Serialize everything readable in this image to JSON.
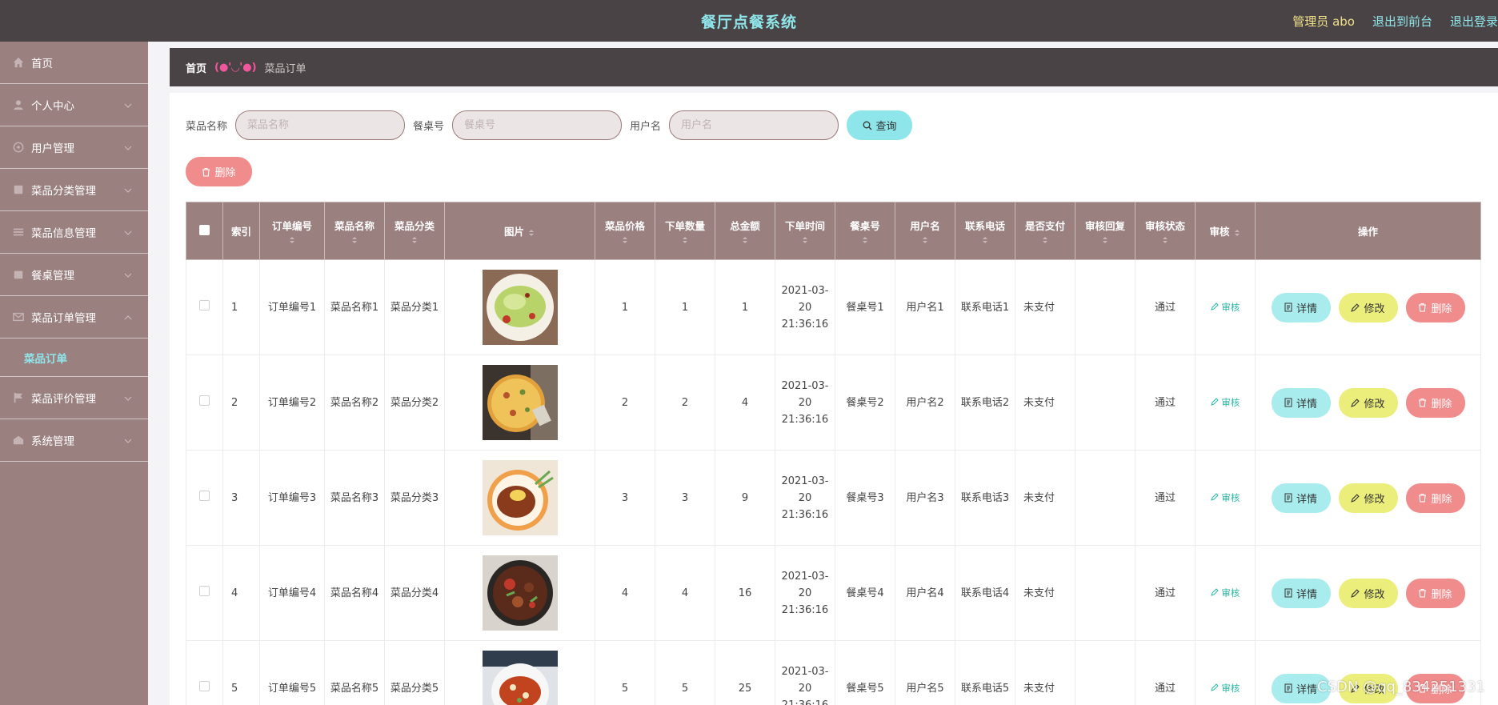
{
  "header": {
    "title": "餐厅点餐系统",
    "admin": "管理员 abo",
    "to_front": "退出到前台",
    "logout": "退出登录"
  },
  "sidebar": {
    "items": [
      {
        "label": "首页",
        "icon": "home-icon"
      },
      {
        "label": "个人中心",
        "icon": "user-icon"
      },
      {
        "label": "用户管理",
        "icon": "users-icon"
      },
      {
        "label": "菜品分类管理",
        "icon": "category-icon"
      },
      {
        "label": "菜品信息管理",
        "icon": "list-icon"
      },
      {
        "label": "餐桌管理",
        "icon": "table-icon"
      },
      {
        "label": "菜品订单管理",
        "icon": "order-icon"
      },
      {
        "label": "菜品评价管理",
        "icon": "flag-icon"
      },
      {
        "label": "系统管理",
        "icon": "system-icon"
      }
    ],
    "active_sub": "菜品订单"
  },
  "breadcrumb": {
    "home": "首页",
    "sep": "(●'◡'●)",
    "current": "菜品订单"
  },
  "search": {
    "dish_label": "菜品名称",
    "dish_placeholder": "菜品名称",
    "table_label": "餐桌号",
    "table_placeholder": "餐桌号",
    "user_label": "用户名",
    "user_placeholder": "用户名",
    "query_label": "查询"
  },
  "toolbar": {
    "delete_label": "删除"
  },
  "table": {
    "headers": [
      "索引",
      "订单编号",
      "菜品名称",
      "菜品分类",
      "图片",
      "菜品价格",
      "下单数量",
      "总金额",
      "下单时间",
      "餐桌号",
      "用户名",
      "联系电话",
      "是否支付",
      "审核回复",
      "审核状态",
      "审核",
      "操作"
    ],
    "review_link": "审核",
    "op_detail": "详情",
    "op_edit": "修改",
    "op_delete": "删除",
    "rows": [
      {
        "idx": "1",
        "order": "订单编号1",
        "dish": "菜品名称1",
        "cat": "菜品分类1",
        "price": "1",
        "qty": "1",
        "total": "1",
        "time": "2021-03-20 21:36:16",
        "table": "餐桌号1",
        "user": "用户名1",
        "phone": "联系电话1",
        "paid": "未支付",
        "reply": "",
        "status": "通过"
      },
      {
        "idx": "2",
        "order": "订单编号2",
        "dish": "菜品名称2",
        "cat": "菜品分类2",
        "price": "2",
        "qty": "2",
        "total": "4",
        "time": "2021-03-20 21:36:16",
        "table": "餐桌号2",
        "user": "用户名2",
        "phone": "联系电话2",
        "paid": "未支付",
        "reply": "",
        "status": "通过"
      },
      {
        "idx": "3",
        "order": "订单编号3",
        "dish": "菜品名称3",
        "cat": "菜品分类3",
        "price": "3",
        "qty": "3",
        "total": "9",
        "time": "2021-03-20 21:36:16",
        "table": "餐桌号3",
        "user": "用户名3",
        "phone": "联系电话3",
        "paid": "未支付",
        "reply": "",
        "status": "通过"
      },
      {
        "idx": "4",
        "order": "订单编号4",
        "dish": "菜品名称4",
        "cat": "菜品分类4",
        "price": "4",
        "qty": "4",
        "total": "16",
        "time": "2021-03-20 21:36:16",
        "table": "餐桌号4",
        "user": "用户名4",
        "phone": "联系电话4",
        "paid": "未支付",
        "reply": "",
        "status": "通过"
      },
      {
        "idx": "5",
        "order": "订单编号5",
        "dish": "菜品名称5",
        "cat": "菜品分类5",
        "price": "5",
        "qty": "5",
        "total": "25",
        "time": "2021-03-20 21:36:16",
        "table": "餐桌号5",
        "user": "用户名5",
        "phone": "联系电话5",
        "paid": "未支付",
        "reply": "",
        "status": "通过"
      }
    ]
  },
  "watermark": "CSDN @qq_834251331",
  "colors": {
    "topbar": "#4a4345",
    "sidebar": "#9b8080",
    "accent": "#8fe6ea",
    "danger": "#f08c8c",
    "edit": "#ecee7c"
  }
}
